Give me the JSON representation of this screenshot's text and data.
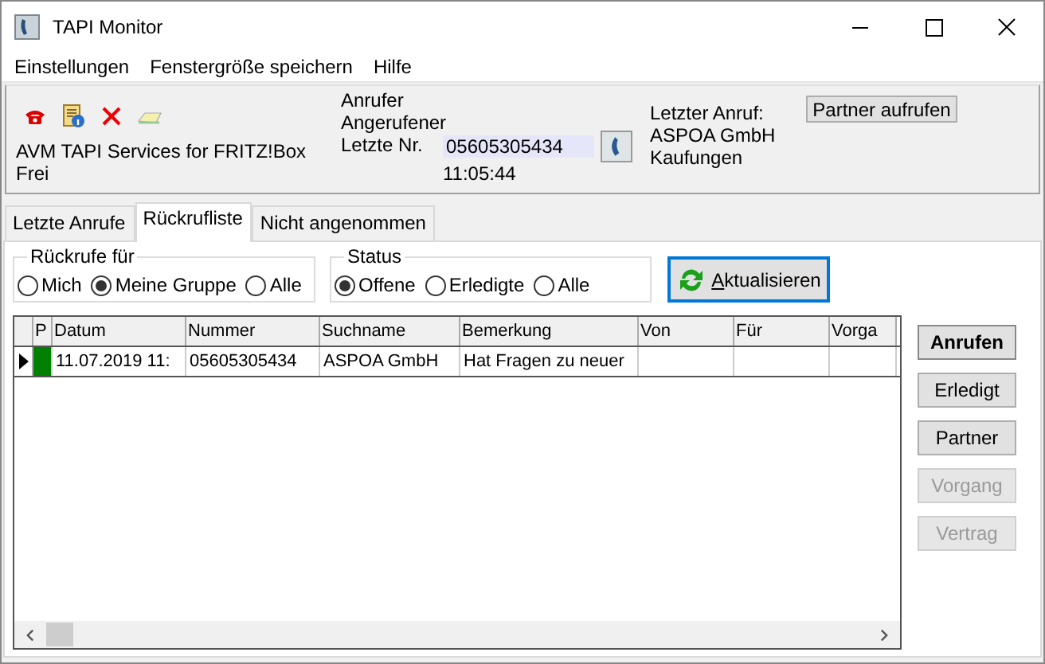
{
  "window": {
    "title": "TAPI Monitor"
  },
  "menu": [
    "Einstellungen",
    "Fenstergröße speichern",
    "Hilfe"
  ],
  "line": {
    "name": "AVM TAPI Services for FRITZ!Box",
    "status": "Frei"
  },
  "call": {
    "labels": [
      "Anrufer",
      "Angerufener",
      "Letzte Nr."
    ],
    "number": "05605305434",
    "time": "11:05:44"
  },
  "last_call": {
    "label": "Letzter Anruf:",
    "name": "ASPOA GmbH",
    "city": "Kaufungen"
  },
  "partner_button": "Partner aufrufen",
  "tabs": [
    {
      "label": "Letzte Anrufe",
      "selected": false
    },
    {
      "label": "Rückrufliste",
      "selected": true
    },
    {
      "label": "Nicht angenommen",
      "selected": false
    }
  ],
  "filters": [
    {
      "title": "Rückrufe für",
      "options": [
        {
          "label": "Mich",
          "selected": false
        },
        {
          "label": "Meine Gruppe",
          "selected": true
        },
        {
          "label": "Alle",
          "selected": false
        }
      ]
    },
    {
      "title": "Status",
      "options": [
        {
          "label": "Offene",
          "selected": true
        },
        {
          "label": "Erledigte",
          "selected": false
        },
        {
          "label": "Alle",
          "selected": false
        }
      ]
    }
  ],
  "refresh_button": {
    "label": "Aktualisieren"
  },
  "table": {
    "columns": [
      "P",
      "Datum",
      "Nummer",
      "Suchname",
      "Bemerkung",
      "Von",
      "Für",
      "Vorga"
    ],
    "rows": [
      {
        "current": true,
        "color": "#008000",
        "cells": [
          "",
          "11.07.2019 11:",
          "05605305434",
          "ASPOA GmbH",
          "Hat Fragen zu neuer",
          "",
          "",
          ""
        ]
      }
    ]
  },
  "actions": [
    {
      "label": "Anrufen",
      "default": true,
      "disabled": false
    },
    {
      "label": "Erledigt",
      "default": false,
      "disabled": false
    },
    {
      "label": "Partner",
      "default": false,
      "disabled": false
    },
    {
      "label": "Vorgang",
      "default": false,
      "disabled": true
    },
    {
      "label": "Vertrag",
      "default": false,
      "disabled": true
    }
  ]
}
